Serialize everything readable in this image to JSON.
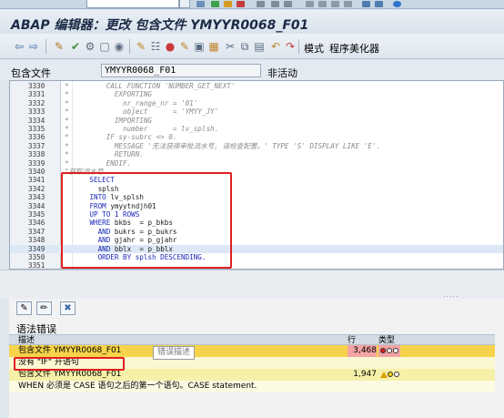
{
  "window": {
    "title": "ABAP 编辑器：更改 包含文件 YMYYR0068_F01"
  },
  "toolbar": {
    "module_label": "模式",
    "pretty_printer_label": "程序美化器"
  },
  "header": {
    "field_label": "包含文件",
    "field_value": "YMYYR0068_F01",
    "status": "非活动"
  },
  "editor": {
    "lines": [
      {
        "no": "3330",
        "text": "*         CALL FUNCTION 'NUMBER_GET_NEXT'",
        "kind": "comment"
      },
      {
        "no": "3331",
        "text": "*           EXPORTING",
        "kind": "comment"
      },
      {
        "no": "3332",
        "text": "*             nr_range_nr = '01'",
        "kind": "comment"
      },
      {
        "no": "3333",
        "text": "*             object      = 'YMYY_JY'",
        "kind": "comment"
      },
      {
        "no": "3334",
        "text": "*           IMPORTING",
        "kind": "comment"
      },
      {
        "no": "3335",
        "text": "*             number      = lv_splsh.",
        "kind": "comment"
      },
      {
        "no": "3336",
        "text": "*         IF sy-subrc <> 0.",
        "kind": "comment"
      },
      {
        "no": "3337",
        "text": "*           MESSAGE '无法获得审批流水号, 请检查配置。' TYPE 'S' DISPLAY LIKE 'E'.",
        "kind": "comment"
      },
      {
        "no": "3338",
        "text": "*           RETURN.",
        "kind": "comment"
      },
      {
        "no": "3339",
        "text": "*         ENDIF.",
        "kind": "comment"
      },
      {
        "no": "3340",
        "text": "\"获取流水号",
        "kind": "comment"
      },
      {
        "no": "3341",
        "text": "      SELECT",
        "kind": "keyword"
      },
      {
        "no": "3342",
        "text": "        splsh",
        "kind": "text"
      },
      {
        "no": "3343",
        "text": "      INTO lv_splsh",
        "kind": "mixed"
      },
      {
        "no": "3344",
        "text": "      FROM ymyytndjh01",
        "kind": "mixed"
      },
      {
        "no": "3345",
        "text": "      UP TO 1 ROWS",
        "kind": "keyword"
      },
      {
        "no": "3346",
        "text": "      WHERE bkbs  = p_bkbs",
        "kind": "mixed"
      },
      {
        "no": "3347",
        "text": "        AND bukrs = p_bukrs",
        "kind": "mixed"
      },
      {
        "no": "3348",
        "text": "        AND gjahr = p_gjahr",
        "kind": "mixed"
      },
      {
        "no": "3349",
        "text": "        AND bblx  = p_bblx",
        "kind": "mixed"
      },
      {
        "no": "3350",
        "text": "        ORDER BY splsh DESCENDING.",
        "kind": "keyword"
      },
      {
        "no": "3351",
        "text": "",
        "kind": "text"
      }
    ]
  },
  "errors_panel": {
    "title": "语法错误",
    "columns": {
      "desc": "描述",
      "line": "行",
      "type": "类型"
    },
    "rows": [
      {
        "desc": "包含文件 YMYYR0068_F01",
        "line": "3,468",
        "kind": "err",
        "icon": "red-light-icon"
      },
      {
        "desc": "没有 \"IF\" 开语句",
        "line": "",
        "kind": "errmsg",
        "icon": ""
      },
      {
        "desc": "包含文件 YMYYR0068_F01",
        "line": "1,947",
        "kind": "warn",
        "icon": "warning-triangle-icon"
      },
      {
        "desc": "WHEN 必须是 CASE 语句之后的第一个语句。CASE statement.",
        "line": "",
        "kind": "warnmsg",
        "icon": ""
      }
    ],
    "tooltip": "错误描述"
  },
  "colors": {
    "highlight_box": "#e02020",
    "error_row": "#f6d34a",
    "warning_row": "#f6f0a8"
  }
}
